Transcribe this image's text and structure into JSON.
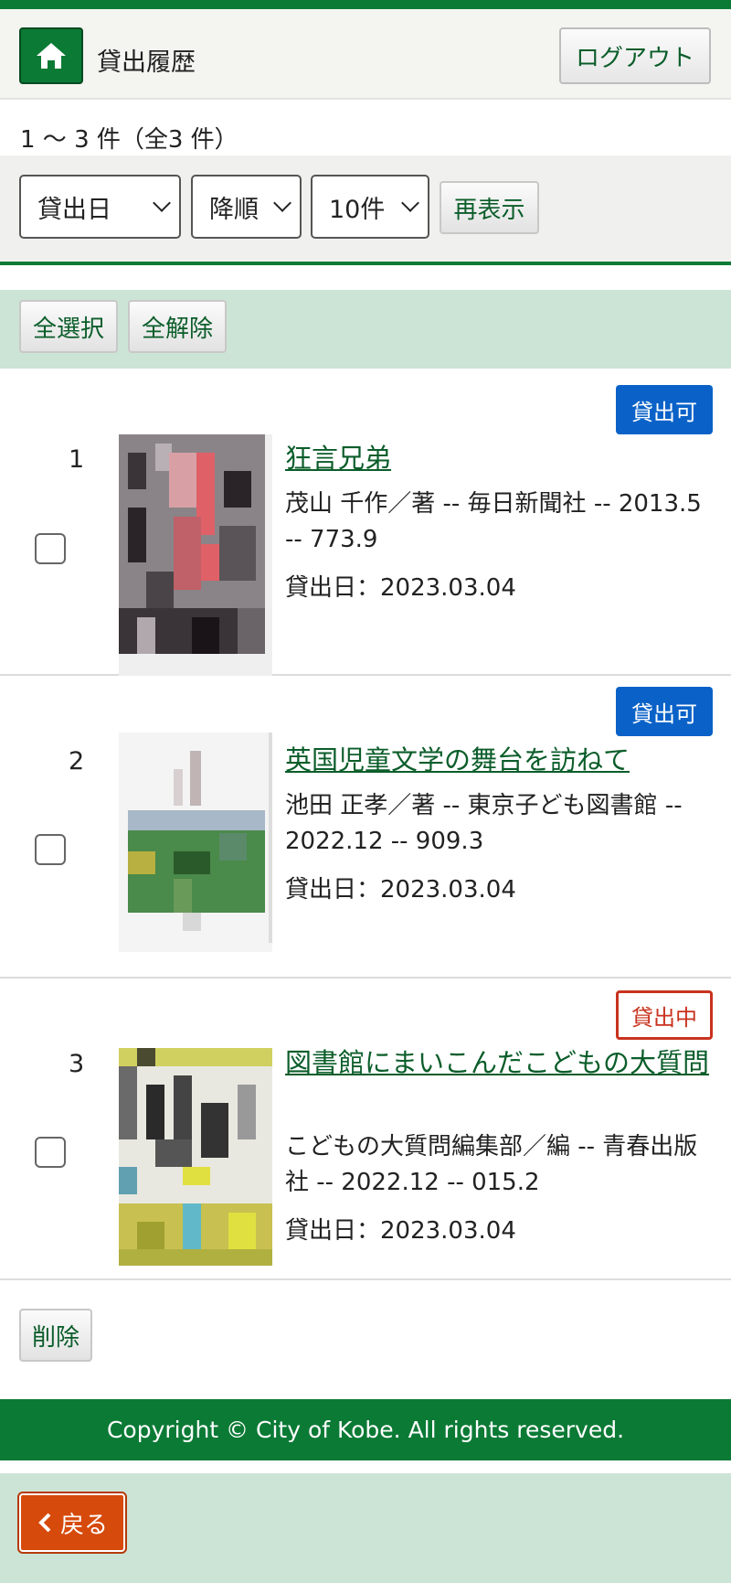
{
  "header": {
    "home_icon": "home-icon",
    "title": "貸出履歴",
    "logout_label": "ログアウト"
  },
  "result_count": "1 ～ 3 件（全3 件）",
  "controls": {
    "sort_field": "貸出日",
    "sort_order": "降順",
    "per_page": "10件",
    "redisplay_label": "再表示"
  },
  "selection": {
    "select_all_label": "全選択",
    "clear_all_label": "全解除"
  },
  "items": [
    {
      "number": "1",
      "status": "貸出可",
      "title": "狂言兄弟",
      "meta": "茂山 千作／著 -- 毎日新聞社 -- 2013.5 -- 773.9",
      "date": "貸出日：2023.03.04"
    },
    {
      "number": "2",
      "status": "貸出可",
      "title": "英国児童文学の舞台を訪ねて",
      "meta": "池田 正孝／著 -- 東京子ども図書館 -- 2022.12 -- 909.3",
      "date": "貸出日：2023.03.04"
    },
    {
      "number": "3",
      "status": "貸出中",
      "title": "図書館にまいこんだこどもの大質問",
      "meta": "こどもの大質問編集部／編 -- 青春出版社 -- 2022.12 -- 015.2",
      "date": "貸出日：2023.03.04"
    }
  ],
  "delete_label": "削除",
  "footer": "Copyright © City of Kobe. All rights reserved.",
  "back_label": "戻る",
  "colors": {
    "brand_green": "#0b7a35",
    "available_blue": "#0a62c8",
    "onloan_red": "#c8321e",
    "back_orange": "#d64a0b"
  }
}
